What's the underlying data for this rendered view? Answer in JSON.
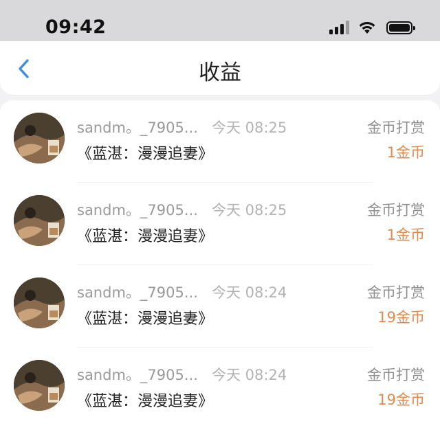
{
  "status_bar": {
    "time": "09:42"
  },
  "header": {
    "title": "收益"
  },
  "records": [
    {
      "username": "sandm。_7905...",
      "time": "今天 08:25",
      "type": "金币打赏",
      "work": "《蓝湛：漫漫追妻》",
      "amount": "1金币"
    },
    {
      "username": "sandm。_7905...",
      "time": "今天 08:25",
      "type": "金币打赏",
      "work": "《蓝湛：漫漫追妻》",
      "amount": "1金币"
    },
    {
      "username": "sandm。_7905...",
      "time": "今天 08:24",
      "type": "金币打赏",
      "work": "《蓝湛：漫漫追妻》",
      "amount": "19金币"
    },
    {
      "username": "sandm。_7905...",
      "time": "今天 08:24",
      "type": "金币打赏",
      "work": "《蓝湛：漫漫追妻》",
      "amount": "19金币"
    }
  ],
  "icons": {
    "back": "chevron-left-icon",
    "signal": "cellular-signal-icon",
    "wifi": "wifi-icon",
    "battery": "battery-icon"
  },
  "colors": {
    "accent_blue": "#3a8ee6",
    "amount_orange": "#e3894a"
  }
}
